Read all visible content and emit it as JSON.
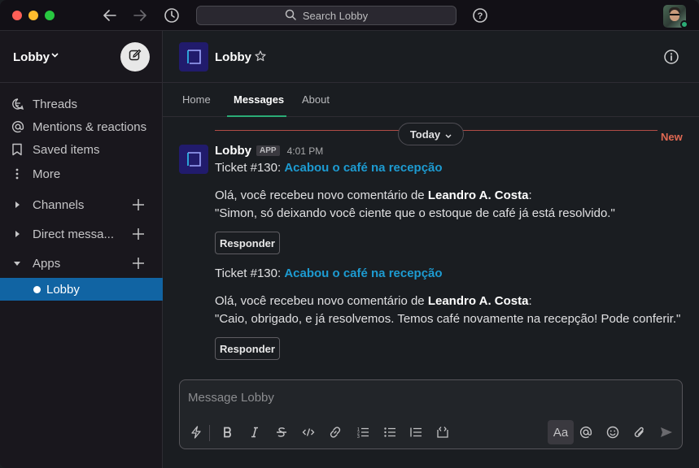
{
  "window": {
    "title": "Lobby"
  },
  "topbar": {
    "search_placeholder": "Search Lobby"
  },
  "sidebar": {
    "workspace": "Lobby",
    "items": [
      {
        "label": "Threads",
        "icon": "threads-icon"
      },
      {
        "label": "Mentions & reactions",
        "icon": "at-icon"
      },
      {
        "label": "Saved items",
        "icon": "bookmark-icon"
      },
      {
        "label": "More",
        "icon": "more-vertical-icon"
      }
    ],
    "sections": [
      {
        "label": "Channels"
      },
      {
        "label": "Direct messa..."
      },
      {
        "label": "Apps"
      }
    ],
    "active_item": {
      "label": "Lobby"
    }
  },
  "channel": {
    "name": "Lobby",
    "tabs": [
      {
        "label": "Home"
      },
      {
        "label": "Messages",
        "selected": true
      },
      {
        "label": "About"
      }
    ]
  },
  "messages": {
    "date_divider": "Today",
    "new_label": "New",
    "sender": "Lobby",
    "app_badge": "APP",
    "time": "4:01 PM",
    "items": [
      {
        "ticket": "Ticket #130:",
        "link": "Acabou o café na recepção",
        "prefix": "Olá, você recebeu novo comentário de",
        "author": "Leandro A. Costa",
        "suffix": ":",
        "comment": "\"Simon, só deixando você ciente que o estoque de café já está resolvido.\"",
        "button": "Responder"
      },
      {
        "ticket": "Ticket #130:",
        "link": "Acabou o café na recepção",
        "prefix": "Olá, você recebeu novo comentário de",
        "author": "Leandro A. Costa",
        "suffix": ":",
        "comment": "\"Caio, obrigado, e já resolvemos. Temos café novamente na recepção! Pode conferir.\"",
        "button": "Responder"
      }
    ]
  },
  "composer": {
    "placeholder": "Message Lobby",
    "format_label": "Aa"
  },
  "colors": {
    "accent_blue": "#1164a3",
    "link": "#1d9bd1",
    "new_divider": "#e06852",
    "presence": "#2bac76",
    "app_icon_bg": "#211b6c"
  }
}
